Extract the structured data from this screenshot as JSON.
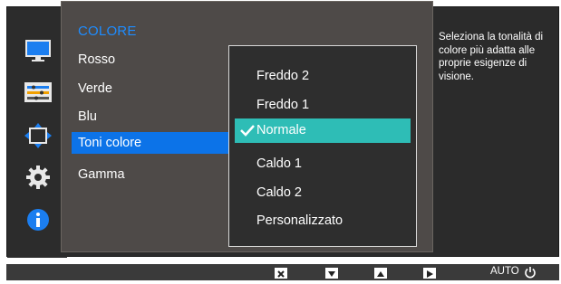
{
  "menu": {
    "section_title": "COLORE",
    "items": [
      {
        "label": "Rosso"
      },
      {
        "label": "Verde"
      },
      {
        "label": "Blu"
      },
      {
        "label": "Toni colore",
        "active": true
      },
      {
        "label": "Gamma"
      }
    ]
  },
  "submenu": {
    "options": [
      {
        "label": "Freddo 2"
      },
      {
        "label": "Freddo 1"
      },
      {
        "label": "Normale",
        "selected": true
      },
      {
        "label": "Caldo 1"
      },
      {
        "label": "Caldo 2"
      },
      {
        "label": "Personalizzato"
      }
    ]
  },
  "help": {
    "text": "Seleziona la tonalità di colore più adatta alle proprie esigenze di visione."
  },
  "sidebar": {
    "icons": [
      "monitor-icon",
      "color-adjust-icon",
      "move-icon",
      "gear-icon",
      "info-icon"
    ]
  },
  "bottom_bar": {
    "buttons": [
      "close-icon",
      "down-arrow-icon",
      "up-arrow-icon",
      "right-arrow-icon"
    ],
    "auto_label": "AUTO",
    "power_icon": "power-icon"
  },
  "colors": {
    "section_title": "#1e8cff",
    "active_item": "#0c73e8",
    "selected_option": "#2ebdb6"
  }
}
